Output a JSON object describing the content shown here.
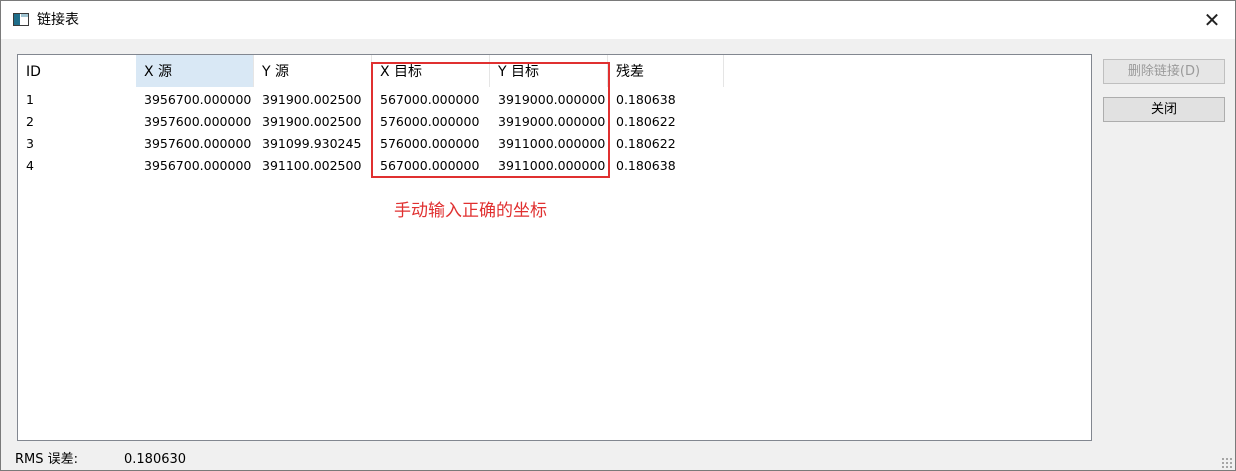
{
  "window": {
    "title": "链接表",
    "close_glyph": "✕"
  },
  "table": {
    "columns": [
      "ID",
      "X 源",
      "Y 源",
      "X 目标",
      "Y 目标",
      "残差"
    ],
    "rows": [
      [
        "1",
        "3956700.000000",
        "391900.002500",
        "567000.000000",
        "3919000.000000",
        "0.180638"
      ],
      [
        "2",
        "3957600.000000",
        "391900.002500",
        "576000.000000",
        "3919000.000000",
        "0.180622"
      ],
      [
        "3",
        "3957600.000000",
        "391099.930245",
        "576000.000000",
        "3911000.000000",
        "0.180622"
      ],
      [
        "4",
        "3956700.000000",
        "391100.002500",
        "567000.000000",
        "3911000.000000",
        "0.180638"
      ]
    ]
  },
  "annotation": {
    "text": "手动输入正确的坐标",
    "color": "#e03030"
  },
  "buttons": {
    "delete_link": "删除链接(D)",
    "close": "关闭"
  },
  "status": {
    "rms_label": "RMS 误差:",
    "rms_value": "0.180630"
  },
  "colors": {
    "sorted_header": "#d9e8f5",
    "window_bg": "#f0f0f0"
  }
}
